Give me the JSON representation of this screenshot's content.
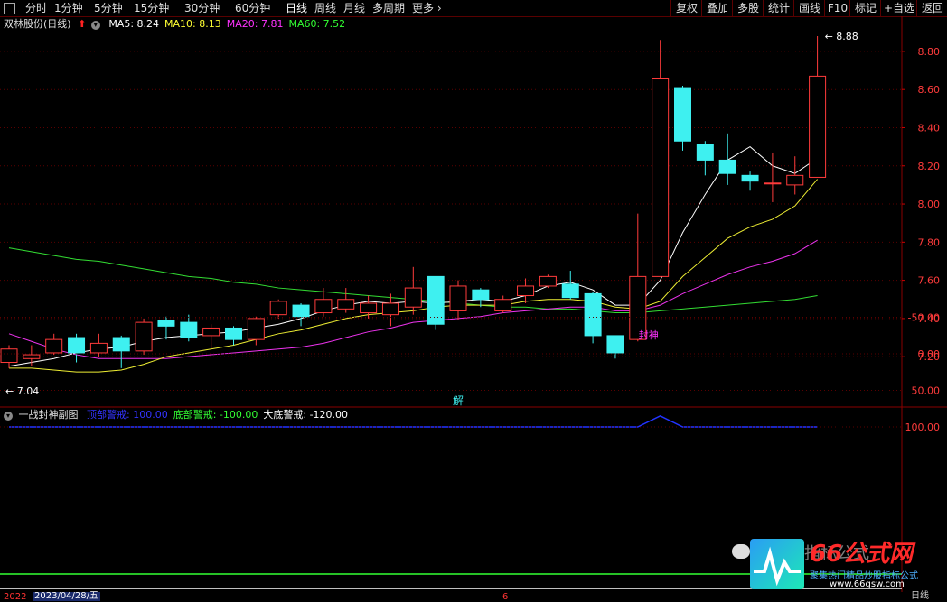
{
  "toolbar": {
    "periods": [
      {
        "label": "分时",
        "active": false
      },
      {
        "label": "1分钟",
        "active": false
      },
      {
        "label": "5分钟",
        "active": false
      },
      {
        "label": "15分钟",
        "active": false
      },
      {
        "label": "30分钟",
        "active": false
      },
      {
        "label": "60分钟",
        "active": false
      },
      {
        "label": "日线",
        "active": true
      },
      {
        "label": "周线",
        "active": false
      },
      {
        "label": "月线",
        "active": false
      },
      {
        "label": "多周期",
        "active": false
      },
      {
        "label": "更多",
        "active": false
      }
    ],
    "more_chevron": "›",
    "right_buttons": [
      "复权",
      "叠加",
      "多股",
      "统计",
      "画线",
      "F10",
      "标记",
      "+自选",
      "返回"
    ]
  },
  "main": {
    "stock_name": "双林股份(日线)",
    "ma": [
      {
        "label": "MA5: 8.24",
        "color": "#ffffff"
      },
      {
        "label": "MA10: 8.13",
        "color": "#ffff33"
      },
      {
        "label": "MA20: 7.81",
        "color": "#ff33ff"
      },
      {
        "label": "MA60: 7.52",
        "color": "#33ff33"
      }
    ],
    "axis": [
      "8.80",
      "8.60",
      "8.40",
      "8.20",
      "8.00",
      "7.80",
      "7.60",
      "7.40",
      "7.20"
    ],
    "high_marker": "8.88",
    "low_marker": "7.04",
    "event_tag": "解"
  },
  "sub": {
    "name": "一战封神副图",
    "items": [
      {
        "label": "顶部警戒: 100.00",
        "color": "#3333ff"
      },
      {
        "label": "底部警戒: -100.00",
        "color": "#33ff33"
      },
      {
        "label": "大底警戒: -120.00",
        "color": "#ffffff"
      }
    ],
    "axis": [
      "100.00",
      "50.00",
      "0.00",
      "-50.00"
    ],
    "signal_label": "封神"
  },
  "footer": {
    "date": "2023/04/28/五",
    "year_prefix": "2022",
    "period_label": "日线",
    "tick": "6"
  },
  "watermark": {
    "brand": "66公式网",
    "slogan": "聚集热门精品炒股指标公式",
    "url": "www.66gsw.com",
    "badge": "指标公式"
  },
  "chart_data": {
    "type": "candlestick",
    "ylim": [
      7.04,
      8.88
    ],
    "candles": [
      {
        "o": 7.17,
        "c": 7.24,
        "h": 7.26,
        "l": 7.14
      },
      {
        "o": 7.19,
        "c": 7.21,
        "h": 7.26,
        "l": 7.15
      },
      {
        "o": 7.22,
        "c": 7.29,
        "h": 7.32,
        "l": 7.21
      },
      {
        "o": 7.3,
        "c": 7.22,
        "h": 7.32,
        "l": 7.17
      },
      {
        "o": 7.22,
        "c": 7.27,
        "h": 7.32,
        "l": 7.2
      },
      {
        "o": 7.3,
        "c": 7.23,
        "h": 7.31,
        "l": 7.14
      },
      {
        "o": 7.23,
        "c": 7.38,
        "h": 7.4,
        "l": 7.21
      },
      {
        "o": 7.39,
        "c": 7.36,
        "h": 7.41,
        "l": 7.29
      },
      {
        "o": 7.38,
        "c": 7.3,
        "h": 7.42,
        "l": 7.28
      },
      {
        "o": 7.31,
        "c": 7.35,
        "h": 7.37,
        "l": 7.24
      },
      {
        "o": 7.35,
        "c": 7.29,
        "h": 7.36,
        "l": 7.26
      },
      {
        "o": 7.29,
        "c": 7.4,
        "h": 7.41,
        "l": 7.26
      },
      {
        "o": 7.42,
        "c": 7.49,
        "h": 7.5,
        "l": 7.4
      },
      {
        "o": 7.47,
        "c": 7.41,
        "h": 7.48,
        "l": 7.36
      },
      {
        "o": 7.43,
        "c": 7.5,
        "h": 7.56,
        "l": 7.41
      },
      {
        "o": 7.45,
        "c": 7.5,
        "h": 7.56,
        "l": 7.43
      },
      {
        "o": 7.43,
        "c": 7.48,
        "h": 7.52,
        "l": 7.4
      },
      {
        "o": 7.42,
        "c": 7.48,
        "h": 7.53,
        "l": 7.36
      },
      {
        "o": 7.46,
        "c": 7.56,
        "h": 7.67,
        "l": 7.42
      },
      {
        "o": 7.62,
        "c": 7.37,
        "h": 7.62,
        "l": 7.34
      },
      {
        "o": 7.44,
        "c": 7.57,
        "h": 7.6,
        "l": 7.39
      },
      {
        "o": 7.55,
        "c": 7.5,
        "h": 7.56,
        "l": 7.46
      },
      {
        "o": 7.44,
        "c": 7.5,
        "h": 7.52,
        "l": 7.43
      },
      {
        "o": 7.52,
        "c": 7.57,
        "h": 7.61,
        "l": 7.48
      },
      {
        "o": 7.57,
        "c": 7.62,
        "h": 7.63,
        "l": 7.56
      },
      {
        "o": 7.58,
        "c": 7.51,
        "h": 7.65,
        "l": 7.5
      },
      {
        "o": 7.53,
        "c": 7.31,
        "h": 7.54,
        "l": 7.27
      },
      {
        "o": 7.31,
        "c": 7.22,
        "h": 7.31,
        "l": 7.19
      },
      {
        "o": 7.29,
        "c": 7.62,
        "h": 7.95,
        "l": 7.28
      },
      {
        "o": 7.62,
        "c": 8.66,
        "h": 8.86,
        "l": 7.62
      },
      {
        "o": 8.61,
        "c": 8.33,
        "h": 8.62,
        "l": 8.28
      },
      {
        "o": 8.31,
        "c": 8.23,
        "h": 8.33,
        "l": 8.15
      },
      {
        "o": 8.23,
        "c": 8.16,
        "h": 8.37,
        "l": 8.1
      },
      {
        "o": 8.15,
        "c": 8.12,
        "h": 8.17,
        "l": 8.07
      },
      {
        "o": 8.11,
        "c": 8.11,
        "h": 8.27,
        "l": 8.01
      },
      {
        "o": 8.1,
        "c": 8.15,
        "h": 8.25,
        "l": 8.05
      },
      {
        "o": 8.14,
        "c": 8.67,
        "h": 8.88,
        "l": 8.14
      }
    ],
    "ma5": [
      7.15,
      7.17,
      7.19,
      7.22,
      7.24,
      7.25,
      7.28,
      7.3,
      7.31,
      7.32,
      7.33,
      7.35,
      7.37,
      7.4,
      7.44,
      7.47,
      7.49,
      7.48,
      7.49,
      7.48,
      7.49,
      7.5,
      7.49,
      7.52,
      7.57,
      7.59,
      7.55,
      7.47,
      7.47,
      7.6,
      7.85,
      8.05,
      8.23,
      8.3,
      8.2,
      8.16,
      8.24
    ],
    "ma10": [
      7.14,
      7.14,
      7.13,
      7.12,
      7.12,
      7.13,
      7.16,
      7.2,
      7.22,
      7.24,
      7.26,
      7.29,
      7.32,
      7.34,
      7.37,
      7.4,
      7.42,
      7.43,
      7.44,
      7.46,
      7.47,
      7.47,
      7.47,
      7.49,
      7.5,
      7.5,
      7.49,
      7.46,
      7.45,
      7.49,
      7.62,
      7.72,
      7.82,
      7.88,
      7.92,
      7.99,
      8.13
    ],
    "ma20": [
      7.32,
      7.28,
      7.24,
      7.21,
      7.19,
      7.19,
      7.19,
      7.19,
      7.2,
      7.21,
      7.22,
      7.23,
      7.24,
      7.25,
      7.27,
      7.3,
      7.33,
      7.35,
      7.38,
      7.39,
      7.4,
      7.41,
      7.43,
      7.44,
      7.45,
      7.46,
      7.46,
      7.44,
      7.44,
      7.47,
      7.53,
      7.58,
      7.63,
      7.67,
      7.7,
      7.74,
      7.81
    ],
    "ma60": [
      7.77,
      7.75,
      7.73,
      7.71,
      7.7,
      7.68,
      7.66,
      7.64,
      7.62,
      7.61,
      7.59,
      7.58,
      7.56,
      7.55,
      7.54,
      7.53,
      7.52,
      7.51,
      7.5,
      7.49,
      7.48,
      7.47,
      7.46,
      7.46,
      7.45,
      7.45,
      7.44,
      7.43,
      7.43,
      7.44,
      7.45,
      7.46,
      7.47,
      7.48,
      7.49,
      7.5,
      7.52
    ],
    "sub_top_line": [
      100,
      100,
      100,
      100,
      100,
      100,
      100,
      100,
      100,
      100,
      100,
      100,
      100,
      100,
      100,
      100,
      100,
      100,
      100,
      100,
      100,
      100,
      100,
      100,
      100,
      100,
      100,
      100,
      100,
      85,
      100,
      100,
      100,
      100,
      100,
      100,
      100
    ],
    "sub_ylim": [
      -95,
      115
    ],
    "bottom_warning": -100,
    "deep_warning": -120,
    "signal_index": 28,
    "signal_bars": [
      {
        "from": -8,
        "to": -27,
        "color": "#ff0000"
      },
      {
        "from": -27,
        "to": -47,
        "color": "#ffffff"
      },
      {
        "from": -47,
        "to": -66,
        "color": "#ffff00"
      }
    ]
  }
}
